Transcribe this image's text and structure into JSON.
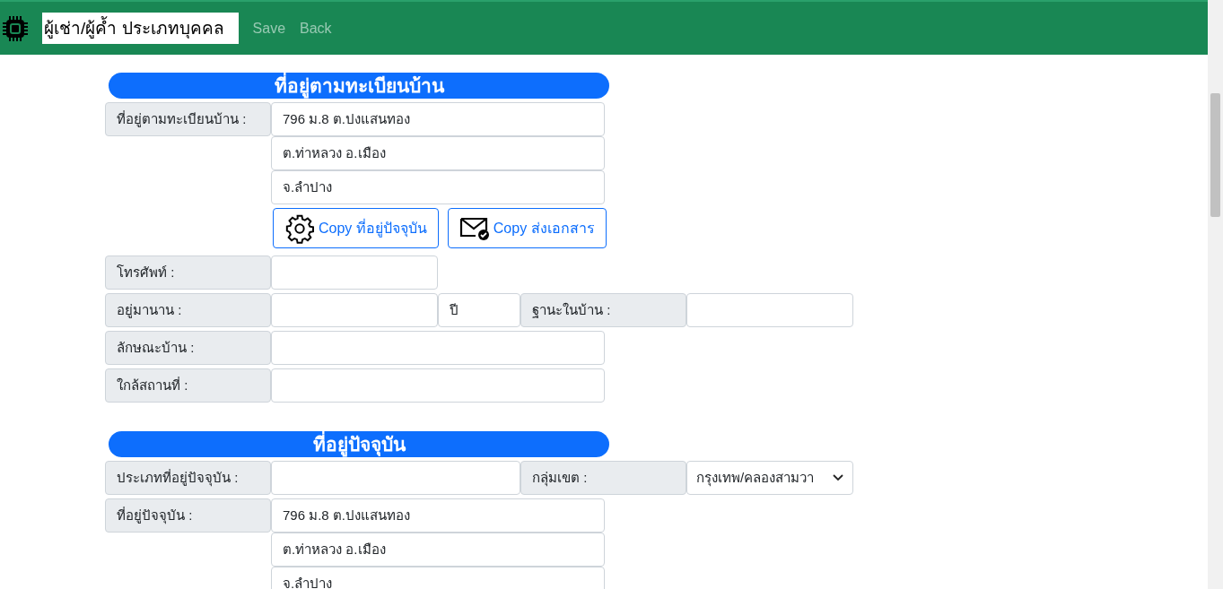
{
  "navbar": {
    "title": "ผู้เช่า/ผู้ค้ำ ประเภทบุคคล",
    "links": [
      "Save",
      "Back"
    ]
  },
  "sections": [
    {
      "heading": "ที่อยู่ตามทะเบียนบ้าน",
      "blocks": [
        {
          "kind": "address",
          "label": "ที่อยู่ตามทะเบียนบ้าน :",
          "lines": [
            "796 ม.8 ต.ปงแสนทอง",
            "ต.ท่าหลวง อ.เมือง",
            "จ.ลำปาง"
          ],
          "buttons": [
            {
              "kind": "gear",
              "label": "Copy ที่อยู่ปัจจุบัน"
            },
            {
              "kind": "mail",
              "label": "Copy ส่งเอกสาร"
            }
          ]
        },
        {
          "kind": "row",
          "cells": [
            {
              "kind": "label",
              "text": "โทรศัพท์ :"
            },
            {
              "kind": "input-short"
            }
          ]
        },
        {
          "kind": "row",
          "cells": [
            {
              "kind": "label",
              "text": "อยู่มานาน :"
            },
            {
              "kind": "input-short"
            },
            {
              "kind": "unit",
              "text": "ปี"
            },
            {
              "kind": "label",
              "text": "ฐานะในบ้าน :"
            },
            {
              "kind": "input-short"
            }
          ]
        },
        {
          "kind": "row",
          "cells": [
            {
              "kind": "label",
              "text": "ลักษณะบ้าน :"
            },
            {
              "kind": "input-wide"
            }
          ]
        },
        {
          "kind": "row",
          "cells": [
            {
              "kind": "label",
              "text": "ใกล้สถานที่ :"
            },
            {
              "kind": "input-wide"
            }
          ]
        }
      ]
    },
    {
      "heading": "ที่อยู่ปัจจุบัน",
      "blocks": [
        {
          "kind": "row",
          "cells": [
            {
              "kind": "label",
              "text": "ประเภทที่อยู่ปัจจุบัน :"
            },
            {
              "kind": "input-medium"
            },
            {
              "kind": "label",
              "text": "กลุ่มเขต :"
            },
            {
              "kind": "select",
              "text": "กรุงเทพ/คลองสามวา"
            }
          ]
        },
        {
          "kind": "address",
          "label": "ที่อยู่ปัจจุบัน :",
          "lines": [
            "796 ม.8 ต.ปงแสนทอง",
            "ต.ท่าหลวง อ.เมือง",
            "จ.ลำปาง"
          ]
        }
      ]
    }
  ]
}
